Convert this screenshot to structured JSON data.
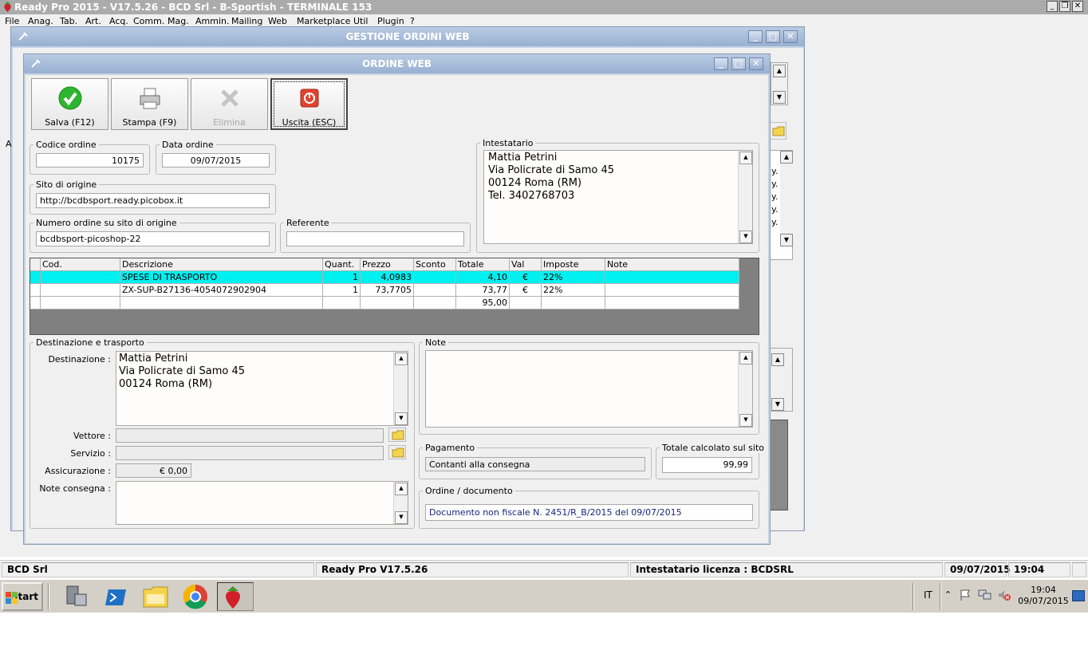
{
  "app": {
    "title": "Ready Pro 2015 - V17.5.26 - BCD Srl - B-Sportish - TERMINALE 153",
    "menu": [
      "File",
      "Anag.",
      "Tab.",
      "Art.",
      "Acq.",
      "Comm.",
      "Mag.",
      "Ammin.",
      "Mailing",
      "Web",
      "Marketplace",
      "Util",
      "Plugin",
      "?"
    ],
    "controls": {
      "minimize": "_",
      "restore": "❐",
      "close": "✕"
    }
  },
  "background_window": {
    "title": "GESTIONE ORDINI WEB",
    "side_label": "A",
    "list_partial_items": [
      "y.",
      "y.",
      "y.",
      "y.",
      "y."
    ]
  },
  "order_window": {
    "title": "ORDINE WEB",
    "toolbar": {
      "save_label": "Salva (F12)",
      "print_label": "Stampa (F9)",
      "delete_label": "Elimina",
      "exit_label": "Uscita (ESC)"
    },
    "codice_ordine": {
      "label": "Codice ordine",
      "value": "10175"
    },
    "data_ordine": {
      "label": "Data ordine",
      "value": "09/07/2015"
    },
    "sito_origine": {
      "label": "Sito di origine",
      "value": "http://bcdbsport.ready.picobox.it"
    },
    "numero_ordine_sito": {
      "label": "Numero ordine su sito di origine",
      "value": "bcdbsport-picoshop-22"
    },
    "referente": {
      "label": "Referente",
      "value": ""
    },
    "intestatario": {
      "label": "Intestatario",
      "lines": [
        "Mattia Petrini",
        "Via Policrate di Samo 45",
        "00124 Roma (RM)",
        "Tel. 3402768703"
      ]
    },
    "grid": {
      "columns": [
        "Cod.",
        "Descrizione",
        "Quant.",
        "Prezzo",
        "Sconto",
        "Totale",
        "Val",
        "Imposte",
        "Note"
      ],
      "rows": [
        {
          "cod": "",
          "descrizione": "SPESE DI TRASPORTO",
          "quant": "1",
          "prezzo": "4,0983",
          "sconto": "",
          "totale": "4,10",
          "val": "€",
          "imposte": "22%",
          "note": ""
        },
        {
          "cod": "",
          "descrizione": "ZX-SUP-B27136-4054072902904",
          "quant": "1",
          "prezzo": "73,7705",
          "sconto": "",
          "totale": "73,77",
          "val": "€",
          "imposte": "22%",
          "note": ""
        }
      ],
      "total": "95,00"
    },
    "destinazione_trasporto": {
      "group_label": "Destinazione e trasporto",
      "destinazione_label": "Destinazione :",
      "destinazione_lines": [
        "Mattia Petrini",
        "Via Policrate di Samo 45",
        "00124 Roma (RM)"
      ],
      "vettore_label": "Vettore :",
      "vettore_value": "",
      "servizio_label": "Servizio :",
      "servizio_value": "",
      "assicurazione_label": "Assicurazione :",
      "assicurazione_value": "€ 0,00",
      "note_consegna_label": "Note consegna :",
      "note_consegna_value": ""
    },
    "note": {
      "label": "Note",
      "value": ""
    },
    "pagamento": {
      "label": "Pagamento",
      "value": "Contanti alla consegna"
    },
    "totale_sito": {
      "label": "Totale calcolato sul sito",
      "value": "99,99"
    },
    "ordine_documento": {
      "label": "Ordine / documento",
      "value": "Documento non fiscale N. 2451/R_B/2015 del 09/07/2015"
    }
  },
  "statusbar": {
    "company": "BCD Srl",
    "version": "Ready Pro V17.5.26",
    "license": "Intestatario licenza : BCDSRL",
    "date": "09/07/2015",
    "time": "19:04"
  },
  "taskbar": {
    "start_label": "Start",
    "language": "IT",
    "clock_time": "19:04",
    "clock_date": "09/07/2015"
  },
  "colors": {
    "selected_row": "#00f0f0",
    "title_bar": "#a7bddb",
    "exit_icon": "#e0432e",
    "save_icon": "#2fb52f"
  }
}
